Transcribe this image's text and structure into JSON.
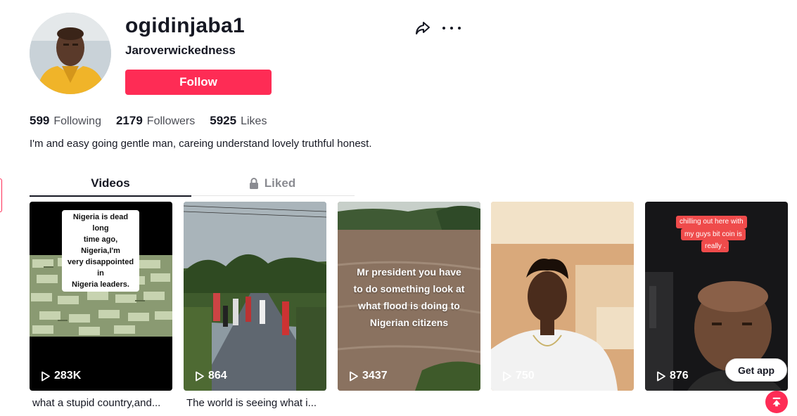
{
  "profile": {
    "username": "ogidinjaba1",
    "nickname": "Jaroverwickedness",
    "follow_label": "Follow",
    "bio": "I'm and easy going gentle man, careing understand lovely truthful honest."
  },
  "stats": [
    {
      "value": "599",
      "label": "Following"
    },
    {
      "value": "2179",
      "label": "Followers"
    },
    {
      "value": "5925",
      "label": "Likes"
    }
  ],
  "tabs": [
    {
      "label": "Videos",
      "active": true
    },
    {
      "label": "Liked",
      "active": false,
      "icon": "lock-icon"
    }
  ],
  "videos": [
    {
      "views": "283K",
      "overlay": [
        "Nigeria is dead long",
        "time ago, Nigeria,I'm",
        "very disappointed in",
        "Nigeria leaders."
      ],
      "description": "what a stupid country,and..."
    },
    {
      "views": "864",
      "overlay": [],
      "description": "The world is seeing what i..."
    },
    {
      "views": "3437",
      "overlay": [
        "Mr president you have",
        "to do something look at",
        "what flood is doing to",
        "Nigerian citizens"
      ],
      "description": ""
    },
    {
      "views": "750",
      "overlay": [],
      "description": ""
    },
    {
      "views": "876",
      "overlay": [
        "chilling out here with",
        "my guys bit coin is",
        "really ."
      ],
      "description": ""
    }
  ],
  "get_app_label": "Get app",
  "colors": {
    "accent": "#fe2c55",
    "text": "#161823",
    "muted": "#8a8b91"
  },
  "icons": [
    "share-icon",
    "more-icon",
    "lock-icon",
    "play-icon",
    "back-to-top-icon"
  ]
}
